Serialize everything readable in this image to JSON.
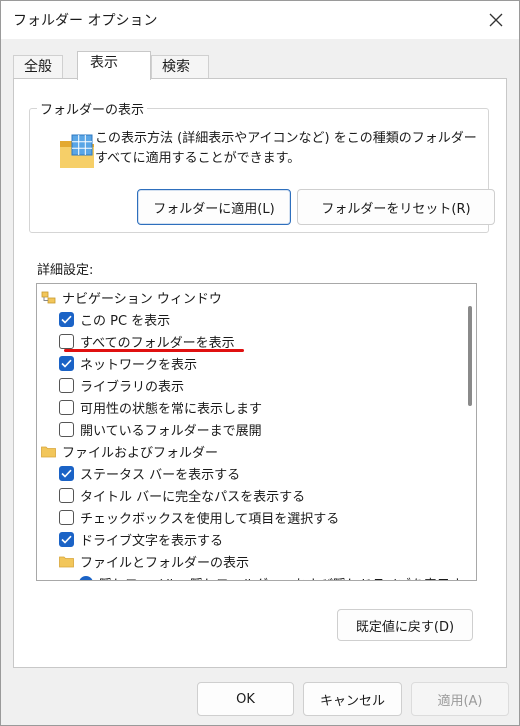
{
  "window": {
    "title": "フォルダー オプション"
  },
  "tabs": [
    {
      "label": "全般"
    },
    {
      "label": "表示"
    },
    {
      "label": "検索"
    }
  ],
  "folder_views": {
    "legend": "フォルダーの表示",
    "description": "この表示方法 (詳細表示やアイコンなど) をこの種類のフォルダーすべてに適用することができます。",
    "apply_button": "フォルダーに適用(L)",
    "reset_button": "フォルダーをリセット(R)"
  },
  "advanced": {
    "label": "詳細設定:",
    "items": [
      {
        "type": "group",
        "label": "ナビゲーション ウィンドウ"
      },
      {
        "type": "checkbox",
        "label": "この PC を表示",
        "checked": true
      },
      {
        "type": "checkbox",
        "label": "すべてのフォルダーを表示",
        "checked": false
      },
      {
        "type": "checkbox",
        "label": "ネットワークを表示",
        "checked": true
      },
      {
        "type": "checkbox",
        "label": "ライブラリの表示",
        "checked": false
      },
      {
        "type": "checkbox",
        "label": "可用性の状態を常に表示します",
        "checked": false
      },
      {
        "type": "checkbox",
        "label": "開いているフォルダーまで展開",
        "checked": false
      },
      {
        "type": "group",
        "label": "ファイルおよびフォルダー"
      },
      {
        "type": "checkbox",
        "label": "ステータス バーを表示する",
        "checked": true
      },
      {
        "type": "checkbox",
        "label": "タイトル バーに完全なパスを表示する",
        "checked": false
      },
      {
        "type": "checkbox",
        "label": "チェックボックスを使用して項目を選択する",
        "checked": false
      },
      {
        "type": "checkbox",
        "label": "ドライブ文字を表示する",
        "checked": true
      },
      {
        "type": "subgroup",
        "label": "ファイルとフォルダーの表示"
      },
      {
        "type": "radio",
        "label": "隠しファイル、隠しフォルダー、および隠しドライブを表示する"
      }
    ],
    "restore_button": "既定値に戻す(D)"
  },
  "footer": {
    "ok": "OK",
    "cancel": "キャンセル",
    "apply": "適用(A)"
  },
  "colors": {
    "accent": "#1b63c6",
    "annotation": "#e01010",
    "folder": "#f2c65a"
  }
}
